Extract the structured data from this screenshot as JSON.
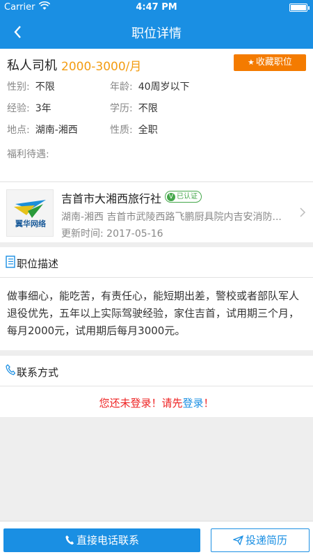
{
  "status_bar": {
    "carrier": "Carrier",
    "time": "4:47 PM"
  },
  "nav": {
    "title": "职位详情"
  },
  "job": {
    "title": "私人司机",
    "salary": "2000-3000/月",
    "favorite_label": "收藏职位",
    "details": [
      {
        "label": "性别:",
        "value": "不限"
      },
      {
        "label": "年龄:",
        "value": "40周岁以下"
      },
      {
        "label": "经验:",
        "value": "3年"
      },
      {
        "label": "学历:",
        "value": "不限"
      },
      {
        "label": "地点:",
        "value": "湖南-湘西"
      },
      {
        "label": "性质:",
        "value": "全职"
      }
    ],
    "benefits_label": "福利待遇:"
  },
  "company": {
    "name": "吉首市大湘西旅行社",
    "verified_label": "已认证",
    "logo_text": "翼华网络",
    "address": "湖南-湘西  吉首市武陵西路飞鹏厨具院内吉安消防...",
    "updated": "更新时间:   2017-05-16"
  },
  "description": {
    "title": "职位描述",
    "text": "做事细心，能吃苦，有责任心，能短期出差，警校或者部队军人退役优先，五年以上实际驾驶经验，家住吉首，试用期三个月，每月2000元，试用期后每月3000元。"
  },
  "contact": {
    "title": "联系方式",
    "notice_prefix": "您还未登录！请先",
    "login_link": "登录",
    "notice_suffix": "！"
  },
  "actions": {
    "call_label": "直接电话联系",
    "apply_label": "投递简历"
  },
  "colors": {
    "primary": "#1a8fe3",
    "salary": "#f39c12",
    "favorite": "#f47b00",
    "warning": "#e22222",
    "verified": "#44a74a"
  },
  "icons": [
    "wifi-icon",
    "battery-icon",
    "back-icon",
    "star-icon",
    "verified-icon",
    "chevron-right-icon",
    "document-icon",
    "phone-icon",
    "send-icon"
  ]
}
